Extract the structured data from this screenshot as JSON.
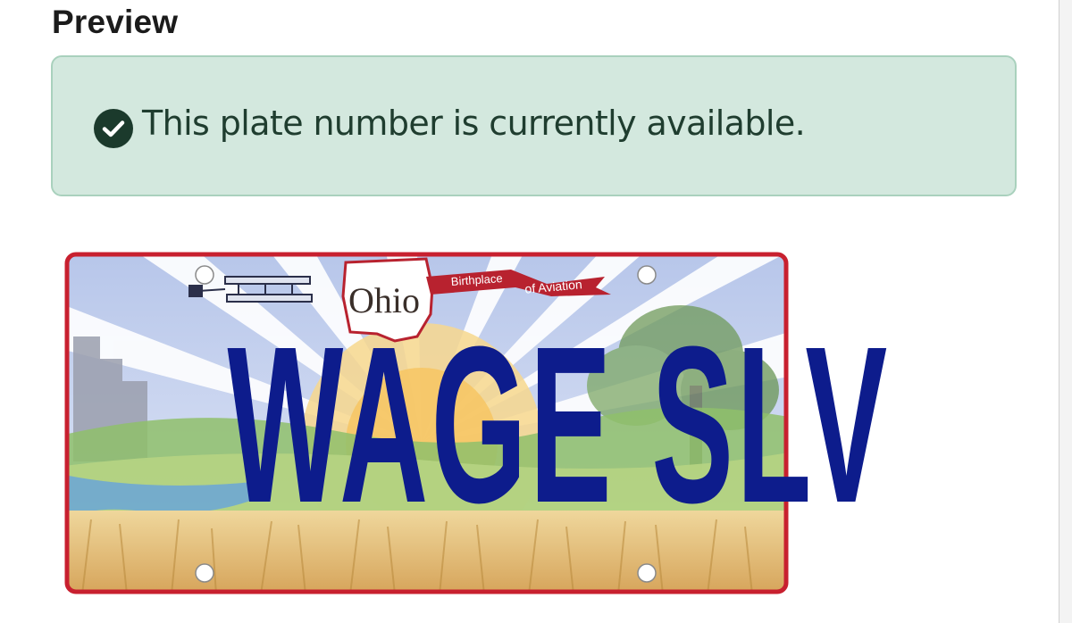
{
  "section": {
    "title": "Preview"
  },
  "availability": {
    "message": "This plate number is currently available.",
    "icon": "check-circle-icon",
    "status_color": "#1f3d2f",
    "background_color": "#d3e8de"
  },
  "plate": {
    "number": "WAGE SLV",
    "state": "Ohio",
    "slogan_line1": "Birthplace",
    "slogan_line2": "of Aviation",
    "text_color": "#0d1c8c",
    "border_color": "#c8202f"
  }
}
